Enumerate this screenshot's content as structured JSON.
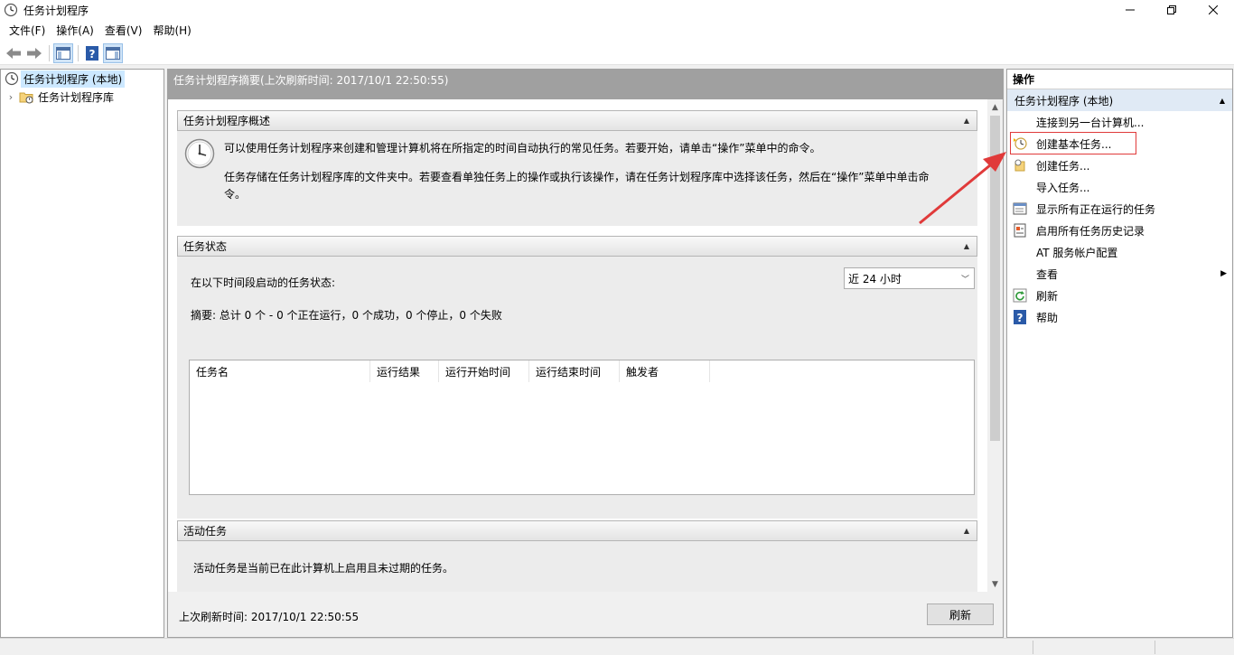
{
  "window": {
    "title": "任务计划程序"
  },
  "menu": [
    "文件(F)",
    "操作(A)",
    "查看(V)",
    "帮助(H)"
  ],
  "tree": {
    "root": "任务计划程序 (本地)",
    "child": "任务计划程序库"
  },
  "center": {
    "header": "任务计划程序摘要(上次刷新时间: 2017/10/1 22:50:55)",
    "overview": {
      "title": "任务计划程序概述",
      "text1": "可以使用任务计划程序来创建和管理计算机将在所指定的时间自动执行的常见任务。若要开始，请单击“操作”菜单中的命令。",
      "text2": "任务存储在任务计划程序库的文件夹中。若要查看单独任务上的操作或执行该操作，请在任务计划程序库中选择该任务，然后在“操作”菜单中单击命令。"
    },
    "status": {
      "title": "任务状态",
      "label": "在以下时间段启动的任务状态:",
      "period": "近 24 小时",
      "summary": "摘要: 总计 0 个 - 0 个正在运行，0 个成功，0 个停止，0 个失败",
      "columns": [
        "任务名",
        "运行结果",
        "运行开始时间",
        "运行结束时间",
        "触发者"
      ]
    },
    "active": {
      "title": "活动任务",
      "text": "活动任务是当前已在此计算机上启用且未过期的任务。"
    },
    "footer": {
      "last_refresh": "上次刷新时间: 2017/10/1 22:50:55",
      "refresh_button": "刷新"
    }
  },
  "actions": {
    "title": "操作",
    "group": "任务计划程序 (本地)",
    "items": [
      {
        "label": "连接到另一台计算机...",
        "icon": "none"
      },
      {
        "label": "创建基本任务...",
        "icon": "create-basic-task-icon"
      },
      {
        "label": "创建任务...",
        "icon": "create-task-icon"
      },
      {
        "label": "导入任务...",
        "icon": "none"
      },
      {
        "label": "显示所有正在运行的任务",
        "icon": "running-tasks-icon"
      },
      {
        "label": "启用所有任务历史记录",
        "icon": "history-icon"
      },
      {
        "label": "AT 服务帐户配置",
        "icon": "none"
      },
      {
        "label": "查看",
        "icon": "none"
      },
      {
        "label": "刷新",
        "icon": "refresh-icon"
      },
      {
        "label": "帮助",
        "icon": "help-icon"
      }
    ]
  },
  "colors": {
    "header_gray": "#a0a0a0",
    "selection_blue": "#cce8ff",
    "annotation_red": "#e03a3a"
  }
}
